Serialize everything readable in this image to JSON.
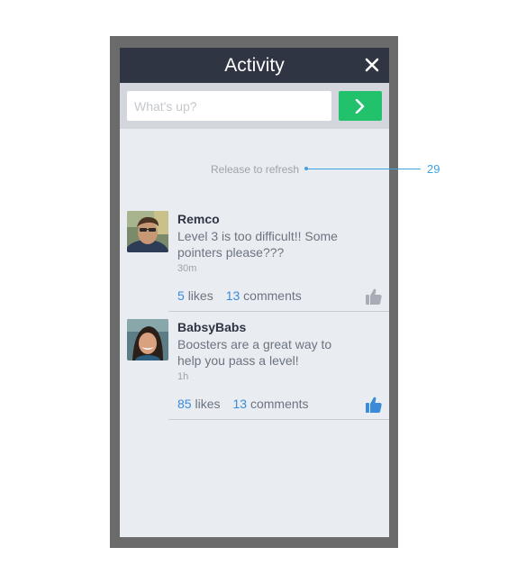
{
  "header": {
    "title": "Activity",
    "close_icon": "close-icon"
  },
  "composer": {
    "placeholder": "What's up?",
    "send_icon": "chevron-right-icon"
  },
  "refresh": {
    "text": "Release to refresh"
  },
  "annotation": {
    "value": "29"
  },
  "feed": [
    {
      "name": "Remco",
      "message": "Level 3 is too difficult!! Some pointers please???",
      "time": "30m",
      "likes_count": "5",
      "likes_label": "likes",
      "comments_count": "13",
      "comments_label": "comments",
      "liked": false
    },
    {
      "name": "BabsyBabs",
      "message": "Boosters are a great way to help you pass a level!",
      "time": "1h",
      "likes_count": "85",
      "likes_label": "likes",
      "comments_count": "13",
      "comments_label": "comments",
      "liked": true
    }
  ],
  "colors": {
    "header_bg": "#2f3542",
    "accent_green": "#22c16b",
    "link_blue": "#3a8bd8",
    "like_active": "#3a8bd8",
    "like_inactive": "#a8adb5"
  }
}
